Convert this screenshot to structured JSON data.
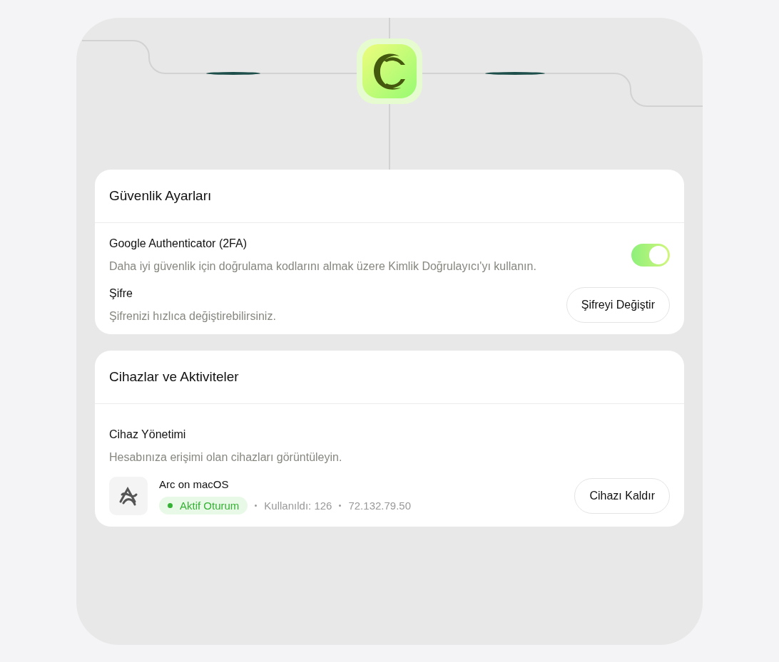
{
  "security": {
    "title": "Güvenlik Ayarları",
    "settings": [
      {
        "kind": "toggle",
        "label": "Google Authenticator (2FA)",
        "description": "Daha iyi güvenlik için doğrulama kodlarını almak üzere Kimlik Doğrulayıcı'yı kullanın.",
        "on": true
      },
      {
        "kind": "button",
        "label": "Şifre",
        "description": "Şifrenizi hızlıca değiştirebilirsiniz.",
        "button": "Şifreyi Değiştir"
      }
    ]
  },
  "devices": {
    "title": "Cihazlar ve Aktiviteler",
    "section_title": "Cihaz Yönetimi",
    "description": "Hesabınıza erişimi olan cihazları görüntüleyin.",
    "items": [
      {
        "name": "Arc on macOS",
        "status": "Aktif Oturum",
        "color": "#34b233",
        "used": "Kullanıldı: 126",
        "ip": "72.132.79.50",
        "button": "Cihazı Kaldır"
      }
    ]
  }
}
